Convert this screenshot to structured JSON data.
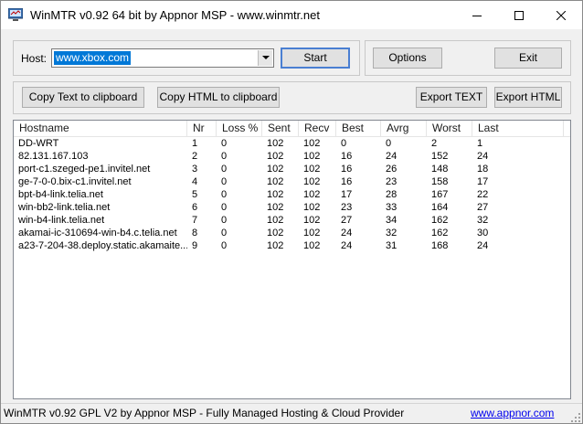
{
  "window": {
    "title": "WinMTR v0.92 64 bit by Appnor MSP - www.winmtr.net",
    "minimize_icon": "minimize-icon",
    "maximize_icon": "maximize-icon",
    "close_icon": "close-icon"
  },
  "host": {
    "label": "Host:",
    "value": "www.xbox.com",
    "dropdown_icon": "chevron-down-icon"
  },
  "buttons": {
    "start": "Start",
    "options": "Options",
    "exit": "Exit",
    "copy_text": "Copy Text to clipboard",
    "copy_html": "Copy HTML to clipboard",
    "export_text": "Export TEXT",
    "export_html": "Export HTML"
  },
  "table": {
    "columns": [
      "Hostname",
      "Nr",
      "Loss %",
      "Sent",
      "Recv",
      "Best",
      "Avrg",
      "Worst",
      "Last"
    ],
    "rows": [
      [
        "DD-WRT",
        "1",
        "0",
        "102",
        "102",
        "0",
        "0",
        "2",
        "1"
      ],
      [
        "82.131.167.103",
        "2",
        "0",
        "102",
        "102",
        "16",
        "24",
        "152",
        "24"
      ],
      [
        "port-c1.szeged-pe1.invitel.net",
        "3",
        "0",
        "102",
        "102",
        "16",
        "26",
        "148",
        "18"
      ],
      [
        "ge-7-0-0.bix-c1.invitel.net",
        "4",
        "0",
        "102",
        "102",
        "16",
        "23",
        "158",
        "17"
      ],
      [
        "bpt-b4-link.telia.net",
        "5",
        "0",
        "102",
        "102",
        "17",
        "28",
        "167",
        "22"
      ],
      [
        "win-bb2-link.telia.net",
        "6",
        "0",
        "102",
        "102",
        "23",
        "33",
        "164",
        "27"
      ],
      [
        "win-b4-link.telia.net",
        "7",
        "0",
        "102",
        "102",
        "27",
        "34",
        "162",
        "32"
      ],
      [
        "akamai-ic-310694-win-b4.c.telia.net",
        "8",
        "0",
        "102",
        "102",
        "24",
        "32",
        "162",
        "30"
      ],
      [
        "a23-7-204-38.deploy.static.akamaite...",
        "9",
        "0",
        "102",
        "102",
        "24",
        "31",
        "168",
        "24"
      ]
    ]
  },
  "statusbar": {
    "text": "WinMTR v0.92 GPL V2 by Appnor MSP - Fully Managed Hosting & Cloud Provider",
    "link": "www.appnor.com"
  },
  "colors": {
    "selection": "#0078d7",
    "default_button_border": "#4a7fd2",
    "link": "#0000ee"
  }
}
